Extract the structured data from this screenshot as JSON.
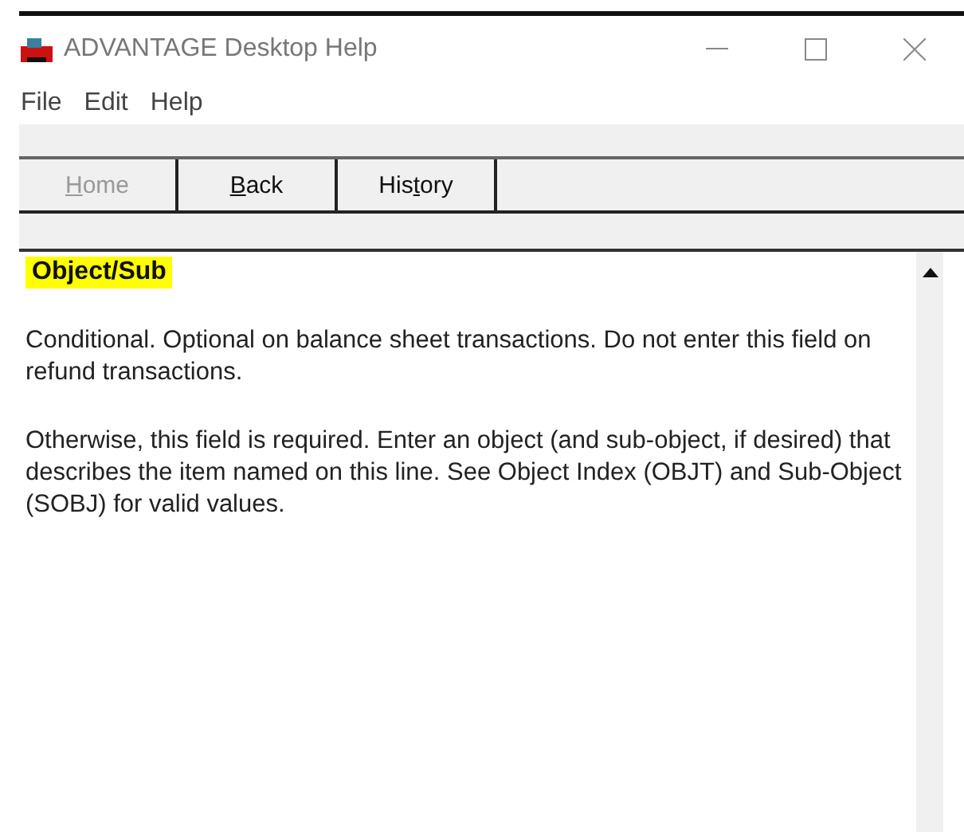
{
  "window": {
    "title": "ADVANTAGE Desktop Help"
  },
  "menu": [
    "File",
    "Edit",
    "Help"
  ],
  "buttons": [
    {
      "key": "H",
      "after": "ome",
      "disabled": true
    },
    {
      "key": "B",
      "after": "ack",
      "disabled": false
    },
    {
      "before": "His",
      "key": "t",
      "after": "ory",
      "disabled": false
    }
  ],
  "topic": {
    "heading": "Object/Sub",
    "paragraphs": [
      "Conditional. Optional on balance sheet transactions. Do not enter this field on refund transactions.",
      "Otherwise, this field is required. Enter an object (and sub-object, if desired) that describes the item named on this line. See Object Index (OBJT) and Sub-Object (SOBJ) for valid values."
    ]
  }
}
